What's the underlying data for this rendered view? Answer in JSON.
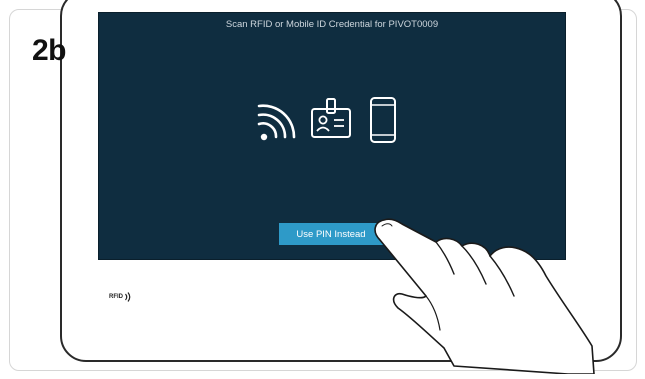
{
  "step": {
    "label": "2b"
  },
  "screen": {
    "title": "Scan RFID or Mobile ID Credential for PIVOT0009",
    "button_label": "Use PIN Instead"
  },
  "reader": {
    "label": "RFID"
  },
  "icons": {
    "credential_icons": [
      "wireless-signal-icon",
      "id-badge-icon",
      "mobile-phone-icon"
    ],
    "reader_icon": "rfid-waves-icon",
    "pointer": "hand-pointer-icon"
  },
  "colors": {
    "screen_background": "#0f2d40",
    "screen_text": "#cdd6dd",
    "button": "#2e9ac8",
    "icon_stroke": "#ffffff"
  }
}
